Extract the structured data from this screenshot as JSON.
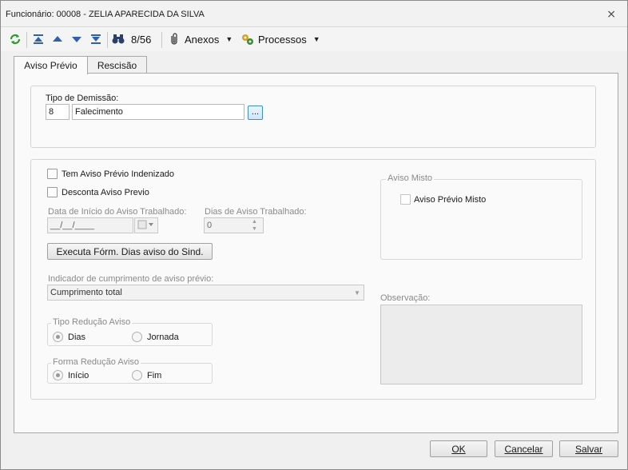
{
  "window": {
    "title": "Funcionário: 00008 - ZELIA APARECIDA DA SILVA",
    "close_glyph": "⨯"
  },
  "toolbar": {
    "record_counter": "8/56",
    "anexos_label": "Anexos",
    "processos_label": "Processos"
  },
  "tabs": [
    {
      "label": "Aviso Prévio",
      "active": true
    },
    {
      "label": "Rescisão",
      "active": false
    }
  ],
  "tipo_demissao": {
    "label": "Tipo de Demissão:",
    "code": "8",
    "description": "Falecimento",
    "lookup_label": "..."
  },
  "aviso": {
    "indenizado_label": "Tem Aviso Prévio Indenizado",
    "desconta_label": "Desconta Aviso Previo",
    "data_inicio_label": "Data de Início do Aviso Trabalhado:",
    "data_inicio_value": "__/__/____",
    "dias_label": "Dias de Aviso Trabalhado:",
    "dias_value": "0",
    "executa_button": "Executa Fórm. Dias aviso do Sind.",
    "indicador_label": "Indicador de cumprimento de aviso prévio:",
    "indicador_value": "Cumprimento total",
    "tipo_reducao_title": "Tipo Redução Aviso",
    "tipo_reducao_options": [
      "Dias",
      "Jornada"
    ],
    "forma_reducao_title": "Forma Redução Aviso",
    "forma_reducao_options": [
      "Início",
      "Fim"
    ]
  },
  "aviso_misto": {
    "title": "Aviso Misto",
    "checkbox_label": "Aviso Prévio Misto"
  },
  "observacao": {
    "label": "Observação:"
  },
  "footer": {
    "ok_label": "OK",
    "cancel_label": "Cancelar",
    "save_label": "Salvar"
  }
}
